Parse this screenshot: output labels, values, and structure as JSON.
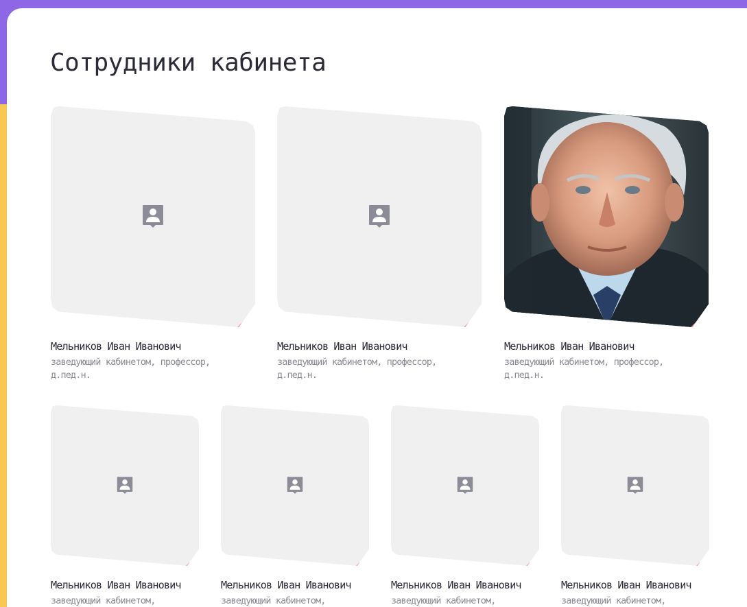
{
  "page": {
    "title": "Сотрудники кабинета"
  },
  "staff_large": [
    {
      "name": "Мельников Иван Иванович",
      "role_line1": "заведующий кабинетом, профессор,",
      "role_line2": "д.пед.н.",
      "photo": "placeholder"
    },
    {
      "name": "Мельников Иван Иванович",
      "role_line1": "заведующий кабинетом, профессор,",
      "role_line2": "д.пед.н.",
      "photo": "placeholder"
    },
    {
      "name": "Мельников Иван Иванович",
      "role_line1": "заведующий кабинетом, профессор,",
      "role_line2": "д.пед.н.",
      "photo": "portrait"
    }
  ],
  "staff_small": [
    {
      "name": "Мельников Иван Иванович",
      "role_line1": "заведующий кабинетом,",
      "photo": "placeholder"
    },
    {
      "name": "Мельников Иван Иванович",
      "role_line1": "заведующий кабинетом,",
      "photo": "placeholder"
    },
    {
      "name": "Мельников Иван Иванович",
      "role_line1": "заведующий кабинетом,",
      "photo": "placeholder"
    },
    {
      "name": "Мельников Иван Иванович",
      "role_line1": "заведующий кабинетом,",
      "photo": "placeholder"
    }
  ],
  "icons": {
    "placeholder": "user-placeholder-icon",
    "corner": "page-corner-fold"
  },
  "colors": {
    "top_bar": "#8e67e6",
    "side_strip": "#f8c850",
    "card_bg": "#f0f0f0",
    "corner_fold": "#f58aa8",
    "icon": "#8c8c98",
    "text_primary": "#2b2b38",
    "text_secondary": "#8a8a94"
  }
}
